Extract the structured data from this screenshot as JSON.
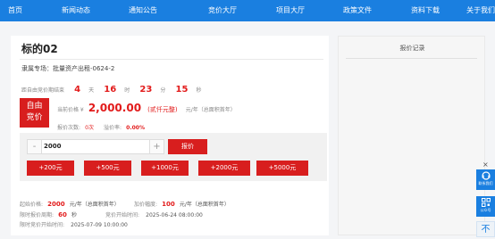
{
  "nav": {
    "items": [
      "首页",
      "新闻动态",
      "通知公告",
      "竞价大厅",
      "项目大厅",
      "政策文件",
      "资料下载",
      "关于我们"
    ]
  },
  "item": {
    "title": "标的02",
    "project_label": "隶属专场：",
    "project_name": "批量资产出租-0624-2",
    "countdown_label": "距自由竞价期结束",
    "countdown": {
      "days": "4",
      "days_unit": "天",
      "hours": "16",
      "hours_unit": "时",
      "minutes": "23",
      "minutes_unit": "分",
      "seconds": "15",
      "seconds_unit": "秒"
    },
    "badge_line1": "自由",
    "badge_line2": "竞价",
    "current_price_label": "当前价格 ¥",
    "current_price": "2,000.00",
    "current_price_words": "(贰仟元整)",
    "current_price_unit": "元/年（总面积首年）",
    "bid_count_label": "报价次数:",
    "bid_count": "0次",
    "premium_label": "溢价率:",
    "premium": "0.00%"
  },
  "bid": {
    "minus": "-",
    "plus": "+",
    "quantity": "2000",
    "submit_label": "报价",
    "increments": [
      "+200元",
      "+500元",
      "+1000元",
      "+2000元",
      "+5000元"
    ]
  },
  "info": {
    "start_price_label": "起始价格:",
    "start_price": "2000",
    "start_price_unit": "元/年（总面积首年）",
    "increment_label": "加价幅度:",
    "increment": "100",
    "increment_unit": "元/年（总面积首年）",
    "limit_period_label": "限时报价周期:",
    "limit_period": "60",
    "limit_period_unit": "秒",
    "auction_start_label": "竞价开始时间:",
    "auction_start": "2025-06-24 08:00:00",
    "limit_start_label": "限时竞价开始时间:",
    "limit_start": "2025-07-09 10:00:00"
  },
  "sidebar": {
    "title": "报价记录"
  },
  "side_tools": {
    "close": "×",
    "tool1_label": "联系我们",
    "tool2_label": "公众号",
    "top": "不"
  },
  "colors": {
    "nav": "#1a7fe0",
    "accent": "#d81e1e"
  }
}
